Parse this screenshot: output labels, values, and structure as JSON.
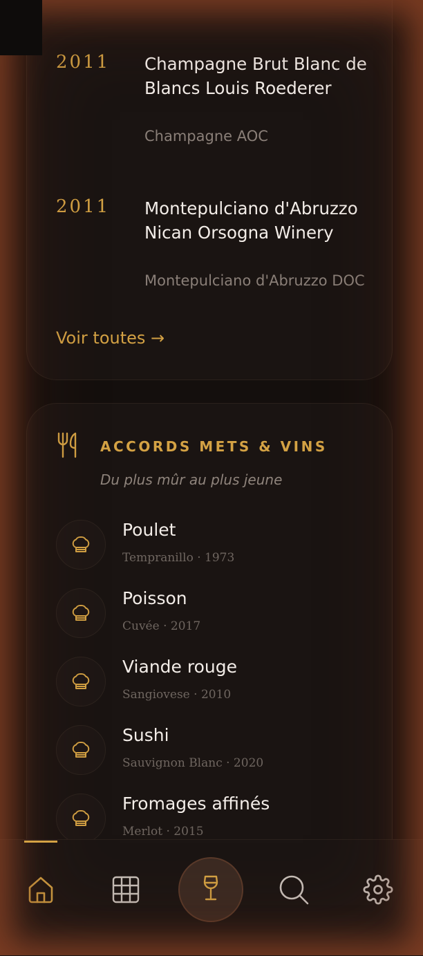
{
  "wines": [
    {
      "vintage": "2011",
      "name": "Champagne Brut Blanc de Blancs Louis Roederer",
      "region": "Champagne AOC"
    },
    {
      "vintage": "2011",
      "name": "Montepulciano d'Abruzzo Nican Orsogna Winery",
      "region": "Montepulciano d'Abruzzo DOC"
    }
  ],
  "see_all": "Voir toutes →",
  "pairings": {
    "title": "ACCORDS METS & VINS",
    "subtitle": "Du plus mûr au plus jeune",
    "items": [
      {
        "food": "Poulet",
        "wine": "Tempranillo · 1973"
      },
      {
        "food": "Poisson",
        "wine": "Cuvée · 2017"
      },
      {
        "food": "Viande rouge",
        "wine": "Sangiovese · 2010"
      },
      {
        "food": "Sushi",
        "wine": "Sauvignon Blanc · 2020"
      },
      {
        "food": "Fromages affinés",
        "wine": "Merlot · 2015"
      }
    ]
  },
  "nav": {
    "items": [
      "home-icon",
      "grid-icon",
      "wine-glass-icon",
      "search-icon",
      "gear-icon"
    ],
    "active": "home-icon"
  },
  "colors": {
    "accent": "#d4a244",
    "background": "#140f0d",
    "card": "#1a1412",
    "muted": "#8a7f78"
  }
}
